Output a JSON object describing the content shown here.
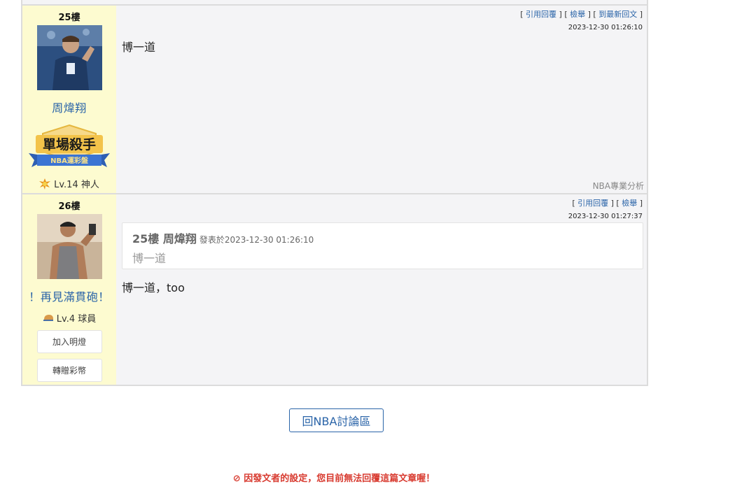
{
  "posts": [
    {
      "floor": "25樓",
      "username": "周煒翔",
      "badge": {
        "line1": "單場殺手",
        "line2": "NBA運彩盤"
      },
      "level": "Lv.14 神人",
      "actions": {
        "open": "[ ",
        "quote": "引用回覆",
        "sep1": " ] [ ",
        "report": "檢舉",
        "sep2": " ] [ ",
        "latest": "到最新回文",
        "close": " ]"
      },
      "timestamp": "2023-12-30 01:26:10",
      "body": "博一道",
      "signature": "NBA專業分析"
    },
    {
      "floor": "26樓",
      "username": "！再見滿貫砲！",
      "level": "Lv.4 球員",
      "buttons": {
        "follow": "加入明燈",
        "gift": "轉贈彩幣"
      },
      "actions": {
        "open": "[ ",
        "quote": "引用回覆",
        "sep1": " ] [ ",
        "report": "檢舉",
        "close": " ]"
      },
      "timestamp": "2023-12-30 01:27:37",
      "quote": {
        "header": "25樓 周煒翔",
        "date": "發表於2023-12-30 01:26:10",
        "text": "博一道"
      },
      "body": "博一道，too"
    }
  ],
  "back_button": "回NBA討論區",
  "notice": "⊘ 因發文者的設定，您目前無法回覆這篇文章喔！",
  "colors": {
    "accent": "#2a64a8",
    "author_bg": "#fdfbd0",
    "warning": "#d83a2f"
  }
}
